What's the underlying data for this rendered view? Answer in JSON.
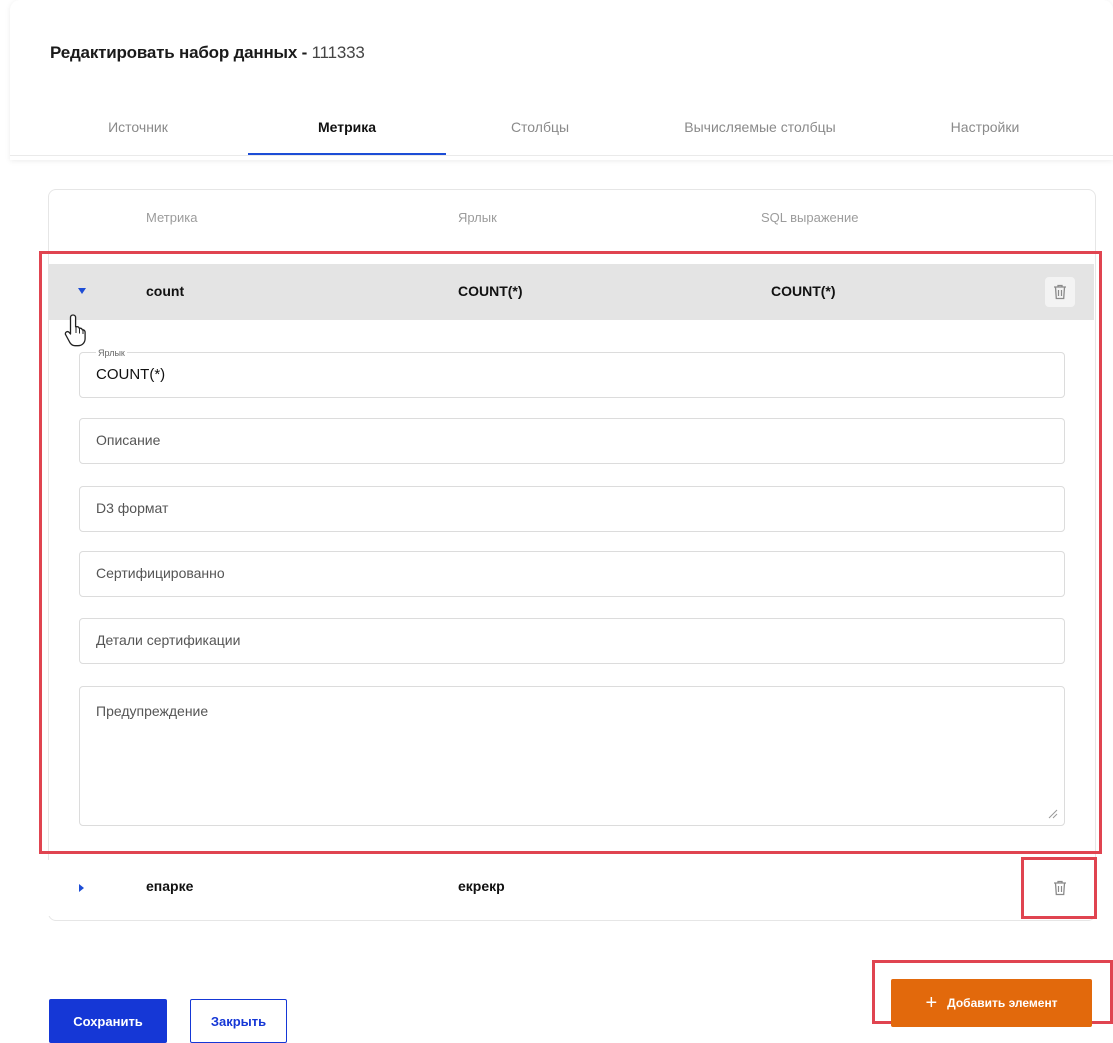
{
  "header": {
    "title_prefix": "Редактировать набор данных - ",
    "dataset_name": "111333"
  },
  "tabs": [
    {
      "label": "Источник",
      "active": false
    },
    {
      "label": "Метрика",
      "active": true
    },
    {
      "label": "Столбцы",
      "active": false
    },
    {
      "label": "Вычисляемые столбцы",
      "active": false
    },
    {
      "label": "Настройки",
      "active": false
    }
  ],
  "table": {
    "columns": [
      "Метрика",
      "Ярлык",
      "SQL выражение"
    ],
    "rows": [
      {
        "metric": "count",
        "label": "COUNT(*)",
        "sql": "COUNT(*)",
        "expanded": true
      },
      {
        "metric": "епарке",
        "label": "екрекр",
        "sql": "",
        "expanded": false
      }
    ]
  },
  "form": {
    "label_field_caption": "Ярлык",
    "label_field_value": "COUNT(*)",
    "description_placeholder": "Описание",
    "d3_format_placeholder": "D3 формат",
    "certified_placeholder": "Сертифицированно",
    "cert_details_placeholder": "Детали сертификации",
    "warning_placeholder": "Предупреждение"
  },
  "footer": {
    "save_label": "Сохранить",
    "close_label": "Закрыть",
    "add_label": "Добавить элемент"
  },
  "colors": {
    "accent_blue": "#1537d6",
    "add_orange": "#e2690c",
    "highlight_red": "#e04450"
  }
}
